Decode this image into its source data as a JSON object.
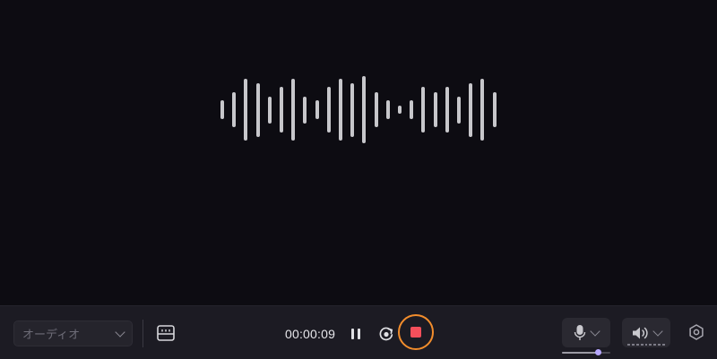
{
  "waveform": {
    "bar_color": "#c7c7cb",
    "bar_levels": [
      0.29,
      0.53,
      0.93,
      0.8,
      0.4,
      0.67,
      0.93,
      0.4,
      0.29,
      0.67,
      0.93,
      0.8,
      1.0,
      0.53,
      0.29,
      0.13,
      0.29,
      0.67,
      0.53,
      0.67,
      0.4,
      0.8,
      0.93,
      0.53
    ]
  },
  "toolbar": {
    "source_select": {
      "label": "オーディオ",
      "icon": "chevron-down-icon"
    },
    "caption_icon": "caption-icon",
    "timer": "00:00:09",
    "pause_icon": "pause-icon",
    "restart_icon": "restart-icon",
    "stop_icon": "stop-icon",
    "stop_ring_color": "#f28d2c",
    "stop_color": "#f44f5b",
    "microphone": {
      "icon": "microphone-icon",
      "dropdown_icon": "chevron-down-icon",
      "volume": 0.75
    },
    "speaker": {
      "icon": "speaker-icon",
      "dropdown_icon": "chevron-down-icon"
    },
    "settings_icon": "settings-icon"
  }
}
